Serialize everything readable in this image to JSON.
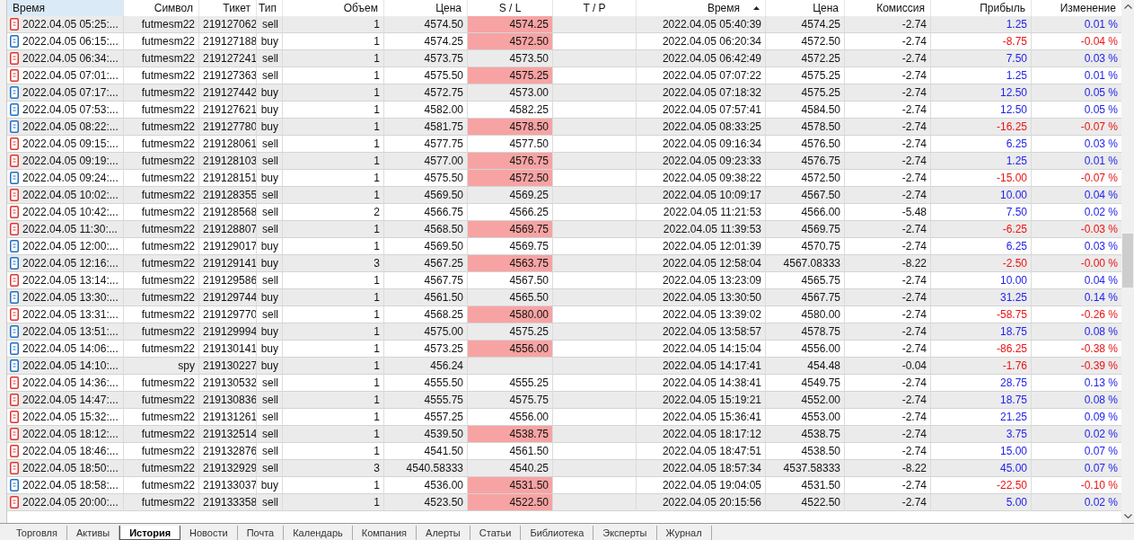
{
  "columns": [
    {
      "label": "Время",
      "highlighted": true,
      "sorted": false
    },
    {
      "label": "Символ",
      "highlighted": false,
      "sorted": false
    },
    {
      "label": "Тикет",
      "highlighted": false,
      "sorted": false
    },
    {
      "label": "Тип",
      "highlighted": false,
      "sorted": false
    },
    {
      "label": "Объем",
      "highlighted": false,
      "sorted": false
    },
    {
      "label": "Цена",
      "highlighted": false,
      "sorted": false
    },
    {
      "label": "S / L",
      "highlighted": false,
      "sorted": false
    },
    {
      "label": "T / P",
      "highlighted": false,
      "sorted": false
    },
    {
      "label": "Время",
      "highlighted": false,
      "sorted": true
    },
    {
      "label": "Цена",
      "highlighted": false,
      "sorted": false
    },
    {
      "label": "Комиссия",
      "highlighted": false,
      "sorted": false
    },
    {
      "label": "Прибыль",
      "highlighted": false,
      "sorted": false
    },
    {
      "label": "Изменение",
      "highlighted": false,
      "sorted": false
    }
  ],
  "rows": [
    {
      "kind": "sell",
      "open_time": "2022.04.05 05:25:...",
      "symbol": "futmesm22",
      "ticket": "219127062",
      "type": "sell",
      "volume": "1",
      "open_price": "4574.50",
      "sl": "4574.25",
      "sl_hit": true,
      "close_time": "2022.04.05 05:40:39",
      "close_price": "4574.25",
      "commission": "-2.74",
      "profit": "1.25",
      "change": "0.01 %",
      "loss": false
    },
    {
      "kind": "buy",
      "open_time": "2022.04.05 06:15:...",
      "symbol": "futmesm22",
      "ticket": "219127188",
      "type": "buy",
      "volume": "1",
      "open_price": "4574.25",
      "sl": "4572.50",
      "sl_hit": true,
      "close_time": "2022.04.05 06:20:34",
      "close_price": "4572.50",
      "commission": "-2.74",
      "profit": "-8.75",
      "change": "-0.04 %",
      "loss": true
    },
    {
      "kind": "sell",
      "open_time": "2022.04.05 06:34:...",
      "symbol": "futmesm22",
      "ticket": "219127241",
      "type": "sell",
      "volume": "1",
      "open_price": "4573.75",
      "sl": "4573.50",
      "sl_hit": false,
      "close_time": "2022.04.05 06:42:49",
      "close_price": "4572.25",
      "commission": "-2.74",
      "profit": "7.50",
      "change": "0.03 %",
      "loss": false
    },
    {
      "kind": "sell",
      "open_time": "2022.04.05 07:01:...",
      "symbol": "futmesm22",
      "ticket": "219127363",
      "type": "sell",
      "volume": "1",
      "open_price": "4575.50",
      "sl": "4575.25",
      "sl_hit": true,
      "close_time": "2022.04.05 07:07:22",
      "close_price": "4575.25",
      "commission": "-2.74",
      "profit": "1.25",
      "change": "0.01 %",
      "loss": false
    },
    {
      "kind": "buy",
      "open_time": "2022.04.05 07:17:...",
      "symbol": "futmesm22",
      "ticket": "219127442",
      "type": "buy",
      "volume": "1",
      "open_price": "4572.75",
      "sl": "4573.00",
      "sl_hit": false,
      "close_time": "2022.04.05 07:18:32",
      "close_price": "4575.25",
      "commission": "-2.74",
      "profit": "12.50",
      "change": "0.05 %",
      "loss": false
    },
    {
      "kind": "buy",
      "open_time": "2022.04.05 07:53:...",
      "symbol": "futmesm22",
      "ticket": "219127621",
      "type": "buy",
      "volume": "1",
      "open_price": "4582.00",
      "sl": "4582.25",
      "sl_hit": false,
      "close_time": "2022.04.05 07:57:41",
      "close_price": "4584.50",
      "commission": "-2.74",
      "profit": "12.50",
      "change": "0.05 %",
      "loss": false
    },
    {
      "kind": "buy",
      "open_time": "2022.04.05 08:22:...",
      "symbol": "futmesm22",
      "ticket": "219127780",
      "type": "buy",
      "volume": "1",
      "open_price": "4581.75",
      "sl": "4578.50",
      "sl_hit": true,
      "close_time": "2022.04.05 08:33:25",
      "close_price": "4578.50",
      "commission": "-2.74",
      "profit": "-16.25",
      "change": "-0.07 %",
      "loss": true
    },
    {
      "kind": "sell",
      "open_time": "2022.04.05 09:15:...",
      "symbol": "futmesm22",
      "ticket": "219128061",
      "type": "sell",
      "volume": "1",
      "open_price": "4577.75",
      "sl": "4577.50",
      "sl_hit": false,
      "close_time": "2022.04.05 09:16:34",
      "close_price": "4576.50",
      "commission": "-2.74",
      "profit": "6.25",
      "change": "0.03 %",
      "loss": false
    },
    {
      "kind": "sell",
      "open_time": "2022.04.05 09:19:...",
      "symbol": "futmesm22",
      "ticket": "219128103",
      "type": "sell",
      "volume": "1",
      "open_price": "4577.00",
      "sl": "4576.75",
      "sl_hit": true,
      "close_time": "2022.04.05 09:23:33",
      "close_price": "4576.75",
      "commission": "-2.74",
      "profit": "1.25",
      "change": "0.01 %",
      "loss": false
    },
    {
      "kind": "buy",
      "open_time": "2022.04.05 09:24:...",
      "symbol": "futmesm22",
      "ticket": "219128151",
      "type": "buy",
      "volume": "1",
      "open_price": "4575.50",
      "sl": "4572.50",
      "sl_hit": true,
      "close_time": "2022.04.05 09:38:22",
      "close_price": "4572.50",
      "commission": "-2.74",
      "profit": "-15.00",
      "change": "-0.07 %",
      "loss": true
    },
    {
      "kind": "sell",
      "open_time": "2022.04.05 10:02:...",
      "symbol": "futmesm22",
      "ticket": "219128355",
      "type": "sell",
      "volume": "1",
      "open_price": "4569.50",
      "sl": "4569.25",
      "sl_hit": false,
      "close_time": "2022.04.05 10:09:17",
      "close_price": "4567.50",
      "commission": "-2.74",
      "profit": "10.00",
      "change": "0.04 %",
      "loss": false
    },
    {
      "kind": "sell",
      "open_time": "2022.04.05 10:42:...",
      "symbol": "futmesm22",
      "ticket": "219128568",
      "type": "sell",
      "volume": "2",
      "open_price": "4566.75",
      "sl": "4566.25",
      "sl_hit": false,
      "close_time": "2022.04.05 11:21:53",
      "close_price": "4566.00",
      "commission": "-5.48",
      "profit": "7.50",
      "change": "0.02 %",
      "loss": false
    },
    {
      "kind": "sell",
      "open_time": "2022.04.05 11:30:...",
      "symbol": "futmesm22",
      "ticket": "219128807",
      "type": "sell",
      "volume": "1",
      "open_price": "4568.50",
      "sl": "4569.75",
      "sl_hit": true,
      "close_time": "2022.04.05 11:39:53",
      "close_price": "4569.75",
      "commission": "-2.74",
      "profit": "-6.25",
      "change": "-0.03 %",
      "loss": true
    },
    {
      "kind": "buy",
      "open_time": "2022.04.05 12:00:...",
      "symbol": "futmesm22",
      "ticket": "219129017",
      "type": "buy",
      "volume": "1",
      "open_price": "4569.50",
      "sl": "4569.75",
      "sl_hit": false,
      "close_time": "2022.04.05 12:01:39",
      "close_price": "4570.75",
      "commission": "-2.74",
      "profit": "6.25",
      "change": "0.03 %",
      "loss": false
    },
    {
      "kind": "buy",
      "open_time": "2022.04.05 12:16:...",
      "symbol": "futmesm22",
      "ticket": "219129141",
      "type": "buy",
      "volume": "3",
      "open_price": "4567.25",
      "sl": "4563.75",
      "sl_hit": true,
      "close_time": "2022.04.05 12:58:04",
      "close_price": "4567.08333",
      "commission": "-8.22",
      "profit": "-2.50",
      "change": "-0.00 %",
      "loss": true
    },
    {
      "kind": "sell",
      "open_time": "2022.04.05 13:14:...",
      "symbol": "futmesm22",
      "ticket": "219129586",
      "type": "sell",
      "volume": "1",
      "open_price": "4567.75",
      "sl": "4567.50",
      "sl_hit": false,
      "close_time": "2022.04.05 13:23:09",
      "close_price": "4565.75",
      "commission": "-2.74",
      "profit": "10.00",
      "change": "0.04 %",
      "loss": false
    },
    {
      "kind": "buy",
      "open_time": "2022.04.05 13:30:...",
      "symbol": "futmesm22",
      "ticket": "219129744",
      "type": "buy",
      "volume": "1",
      "open_price": "4561.50",
      "sl": "4565.50",
      "sl_hit": false,
      "close_time": "2022.04.05 13:30:50",
      "close_price": "4567.75",
      "commission": "-2.74",
      "profit": "31.25",
      "change": "0.14 %",
      "loss": false
    },
    {
      "kind": "sell",
      "open_time": "2022.04.05 13:31:...",
      "symbol": "futmesm22",
      "ticket": "219129770",
      "type": "sell",
      "volume": "1",
      "open_price": "4568.25",
      "sl": "4580.00",
      "sl_hit": true,
      "close_time": "2022.04.05 13:39:02",
      "close_price": "4580.00",
      "commission": "-2.74",
      "profit": "-58.75",
      "change": "-0.26 %",
      "loss": true
    },
    {
      "kind": "buy",
      "open_time": "2022.04.05 13:51:...",
      "symbol": "futmesm22",
      "ticket": "219129994",
      "type": "buy",
      "volume": "1",
      "open_price": "4575.00",
      "sl": "4575.25",
      "sl_hit": false,
      "close_time": "2022.04.05 13:58:57",
      "close_price": "4578.75",
      "commission": "-2.74",
      "profit": "18.75",
      "change": "0.08 %",
      "loss": false
    },
    {
      "kind": "buy",
      "open_time": "2022.04.05 14:06:...",
      "symbol": "futmesm22",
      "ticket": "219130141",
      "type": "buy",
      "volume": "1",
      "open_price": "4573.25",
      "sl": "4556.00",
      "sl_hit": true,
      "close_time": "2022.04.05 14:15:04",
      "close_price": "4556.00",
      "commission": "-2.74",
      "profit": "-86.25",
      "change": "-0.38 %",
      "loss": true
    },
    {
      "kind": "buy",
      "open_time": "2022.04.05 14:10:...",
      "symbol": "spy",
      "ticket": "219130227",
      "type": "buy",
      "volume": "1",
      "open_price": "456.24",
      "close_time": "2022.04.05 14:17:41",
      "close_price": "454.48",
      "commission": "-0.04",
      "profit": "-1.76",
      "change": "-0.39 %",
      "loss": true
    },
    {
      "kind": "sell",
      "open_time": "2022.04.05 14:36:...",
      "symbol": "futmesm22",
      "ticket": "219130532",
      "type": "sell",
      "volume": "1",
      "open_price": "4555.50",
      "sl": "4555.25",
      "sl_hit": false,
      "close_time": "2022.04.05 14:38:41",
      "close_price": "4549.75",
      "commission": "-2.74",
      "profit": "28.75",
      "change": "0.13 %",
      "loss": false
    },
    {
      "kind": "sell",
      "open_time": "2022.04.05 14:47:...",
      "symbol": "futmesm22",
      "ticket": "219130836",
      "type": "sell",
      "volume": "1",
      "open_price": "4555.75",
      "sl": "4575.75",
      "sl_hit": false,
      "close_time": "2022.04.05 15:19:21",
      "close_price": "4552.00",
      "commission": "-2.74",
      "profit": "18.75",
      "change": "0.08 %",
      "loss": false
    },
    {
      "kind": "sell",
      "open_time": "2022.04.05 15:32:...",
      "symbol": "futmesm22",
      "ticket": "219131261",
      "type": "sell",
      "volume": "1",
      "open_price": "4557.25",
      "sl": "4556.00",
      "sl_hit": false,
      "close_time": "2022.04.05 15:36:41",
      "close_price": "4553.00",
      "commission": "-2.74",
      "profit": "21.25",
      "change": "0.09 %",
      "loss": false
    },
    {
      "kind": "sell",
      "open_time": "2022.04.05 18:12:...",
      "symbol": "futmesm22",
      "ticket": "219132514",
      "type": "sell",
      "volume": "1",
      "open_price": "4539.50",
      "sl": "4538.75",
      "sl_hit": true,
      "close_time": "2022.04.05 18:17:12",
      "close_price": "4538.75",
      "commission": "-2.74",
      "profit": "3.75",
      "change": "0.02 %",
      "loss": false
    },
    {
      "kind": "sell",
      "open_time": "2022.04.05 18:46:...",
      "symbol": "futmesm22",
      "ticket": "219132876",
      "type": "sell",
      "volume": "1",
      "open_price": "4541.50",
      "sl": "4561.50",
      "sl_hit": false,
      "close_time": "2022.04.05 18:47:51",
      "close_price": "4538.50",
      "commission": "-2.74",
      "profit": "15.00",
      "change": "0.07 %",
      "loss": false
    },
    {
      "kind": "sell",
      "open_time": "2022.04.05 18:50:...",
      "symbol": "futmesm22",
      "ticket": "219132929",
      "type": "sell",
      "volume": "3",
      "open_price": "4540.58333",
      "sl": "4540.25",
      "sl_hit": false,
      "close_time": "2022.04.05 18:57:34",
      "close_price": "4537.58333",
      "commission": "-8.22",
      "profit": "45.00",
      "change": "0.07 %",
      "loss": false
    },
    {
      "kind": "buy",
      "open_time": "2022.04.05 18:58:...",
      "symbol": "futmesm22",
      "ticket": "219133037",
      "type": "buy",
      "volume": "1",
      "open_price": "4536.00",
      "sl": "4531.50",
      "sl_hit": true,
      "close_time": "2022.04.05 19:04:05",
      "close_price": "4531.50",
      "commission": "-2.74",
      "profit": "-22.50",
      "change": "-0.10 %",
      "loss": true
    },
    {
      "kind": "sell",
      "open_time": "2022.04.05 20:00:...",
      "symbol": "futmesm22",
      "ticket": "219133358",
      "type": "sell",
      "volume": "1",
      "open_price": "4523.50",
      "sl": "4522.50",
      "sl_hit": true,
      "close_time": "2022.04.05 20:15:56",
      "close_price": "4522.50",
      "commission": "-2.74",
      "profit": "5.00",
      "change": "0.02 %",
      "loss": false
    }
  ],
  "tabs": [
    {
      "label": "Торговля",
      "selected": false
    },
    {
      "label": "Активы",
      "selected": false
    },
    {
      "label": "История",
      "selected": true
    },
    {
      "label": "Новости",
      "selected": false
    },
    {
      "label": "Почта",
      "selected": false
    },
    {
      "label": "Календарь",
      "selected": false
    },
    {
      "label": "Компания",
      "selected": false
    },
    {
      "label": "Алерты",
      "selected": false
    },
    {
      "label": "Статьи",
      "selected": false
    },
    {
      "label": "Библиотека",
      "selected": false
    },
    {
      "label": "Эксперты",
      "selected": false
    },
    {
      "label": "Журнал",
      "selected": false
    }
  ]
}
